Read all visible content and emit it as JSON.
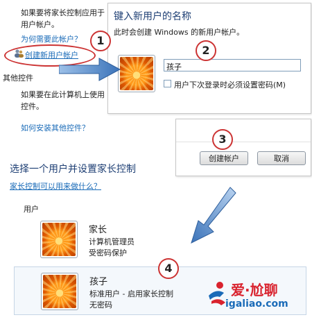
{
  "left_panel": {
    "intro_line1": "如果要将家长控制应用于",
    "intro_line2": "用户帐户。",
    "why_link": "为何需要此帐户？",
    "create_link": "创建新用户帐户",
    "other_controls_heading": "其他控件",
    "other_line1": "如果要在此计算机上使用",
    "other_line2": "控件。",
    "install_link": "如何安装其他控件？"
  },
  "dialog": {
    "title": "键入新用户的名称",
    "subtitle": "此时会创建 Windows 的新用户帐户。",
    "name_value": "孩子",
    "require_password_label": "用户下次登录时必须设置密码(M)"
  },
  "buttons": {
    "create_label": "创建帐户",
    "cancel_label": "取消"
  },
  "page": {
    "heading": "选择一个用户并设置家长控制",
    "help_link": "家长控制可以用来做什么？",
    "users_label": "用户"
  },
  "users": [
    {
      "name": "家长",
      "line1": "计算机管理员",
      "line2": "受密码保护"
    },
    {
      "name": "孩子",
      "line1": "标准用户 - 启用家长控制",
      "line2": "无密码"
    }
  ],
  "callouts": [
    "1",
    "2",
    "3",
    "4"
  ],
  "watermark": {
    "brand": "爱·尬聊",
    "domain": "igaliao.com"
  },
  "colors": {
    "link": "#1a6bb8",
    "callout_ring": "#cc3333",
    "arrow": "#3b73b9",
    "brand_red": "#d9232e"
  }
}
